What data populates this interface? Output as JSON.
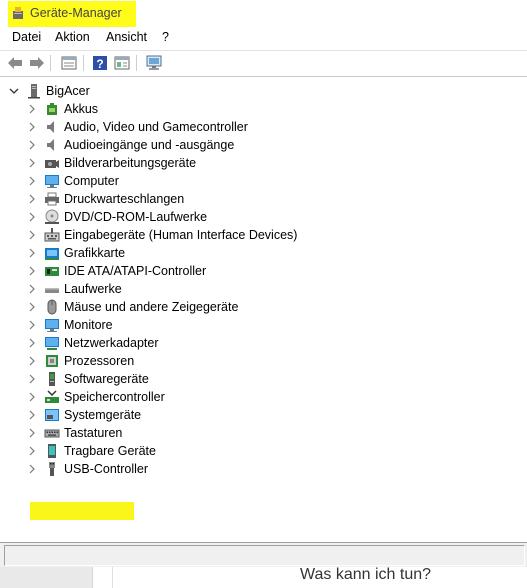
{
  "window": {
    "title": "Geräte-Manager"
  },
  "menu": [
    "Datei",
    "Aktion",
    "Ansicht",
    "?"
  ],
  "toolbar": [
    "back-icon",
    "forward-icon",
    "properties-icon",
    "help-icon",
    "details-icon",
    "monitor-scan-icon"
  ],
  "tree": {
    "root": "BigAcer",
    "items": [
      {
        "label": "Akkus",
        "icon": "battery-icon"
      },
      {
        "label": "Audio, Video und Gamecontroller",
        "icon": "speaker-icon"
      },
      {
        "label": "Audioeingänge und -ausgänge",
        "icon": "speaker-icon"
      },
      {
        "label": "Bildverarbeitungsgeräte",
        "icon": "camera-icon"
      },
      {
        "label": "Computer",
        "icon": "computer-icon"
      },
      {
        "label": "Druckwarteschlangen",
        "icon": "printer-icon"
      },
      {
        "label": "DVD/CD-ROM-Laufwerke",
        "icon": "dvd-icon"
      },
      {
        "label": "Eingabegeräte (Human Interface Devices)",
        "icon": "hid-icon"
      },
      {
        "label": "Grafikkarte",
        "icon": "display-adapter-icon"
      },
      {
        "label": "IDE ATA/ATAPI-Controller",
        "icon": "ide-icon"
      },
      {
        "label": "Laufwerke",
        "icon": "disk-drive-icon"
      },
      {
        "label": "Mäuse und andere Zeigegeräte",
        "icon": "mouse-icon"
      },
      {
        "label": "Monitore",
        "icon": "monitor-icon"
      },
      {
        "label": "Netzwerkadapter",
        "icon": "network-adapter-icon"
      },
      {
        "label": "Prozessoren",
        "icon": "processor-icon"
      },
      {
        "label": "Softwaregeräte",
        "icon": "software-device-icon"
      },
      {
        "label": "Speichercontroller",
        "icon": "storage-controller-icon"
      },
      {
        "label": "Systemgeräte",
        "icon": "system-device-icon"
      },
      {
        "label": "Tastaturen",
        "icon": "keyboard-icon",
        "highlighted": true
      },
      {
        "label": "Tragbare Geräte",
        "icon": "portable-device-icon"
      },
      {
        "label": "USB-Controller",
        "icon": "usb-icon"
      }
    ]
  },
  "background_page": {
    "question": "Was kann ich tun?"
  },
  "colors": {
    "highlight": "#fbf61a",
    "selection_blue": "#1979ca"
  }
}
